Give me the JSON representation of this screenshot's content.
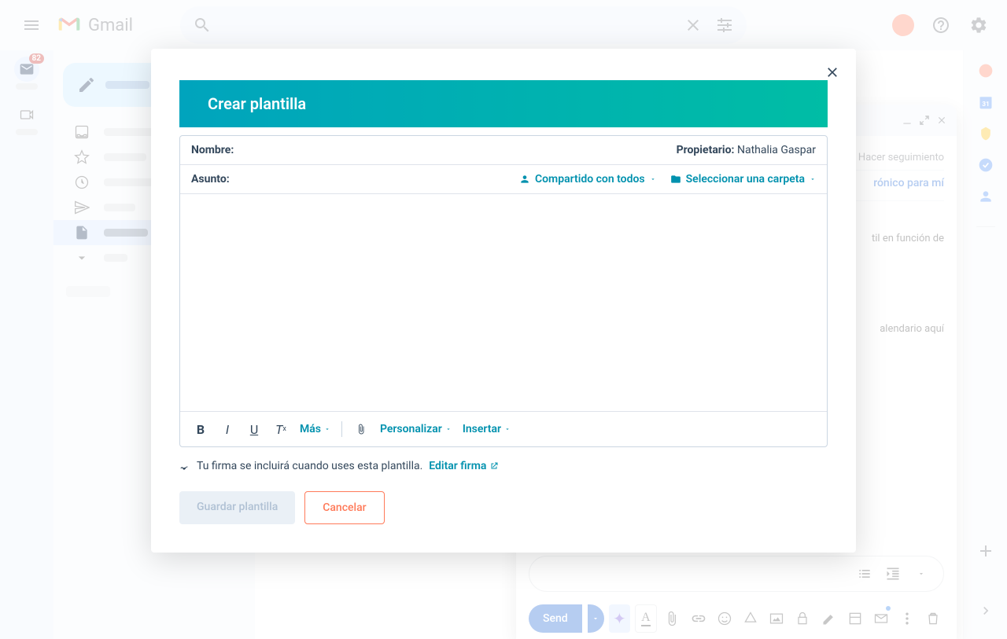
{
  "header": {
    "app_name": "Gmail",
    "search_placeholder": "",
    "badge_count": "82"
  },
  "compose": {
    "followup_label": "Hacer seguimiento",
    "right_link_suffix": "rónico para mí",
    "body_fragment_1": "til en función de",
    "body_fragment_2": "alendario aquí",
    "send_label": "Send"
  },
  "modal": {
    "title": "Crear plantilla",
    "name_label": "Nombre:",
    "owner_label": "Propietario:",
    "owner_name": "Nathalia Gaspar",
    "subject_label": "Asunto:",
    "share_label": "Compartido con todos",
    "folder_label": "Seleccionar una carpeta",
    "more_label": "Más",
    "personalize_label": "Personalizar",
    "insert_label": "Insertar",
    "signature_text": "Tu firma se incluirá cuando uses esta plantilla.",
    "signature_link": "Editar firma",
    "save_label": "Guardar plantilla",
    "cancel_label": "Cancelar"
  }
}
